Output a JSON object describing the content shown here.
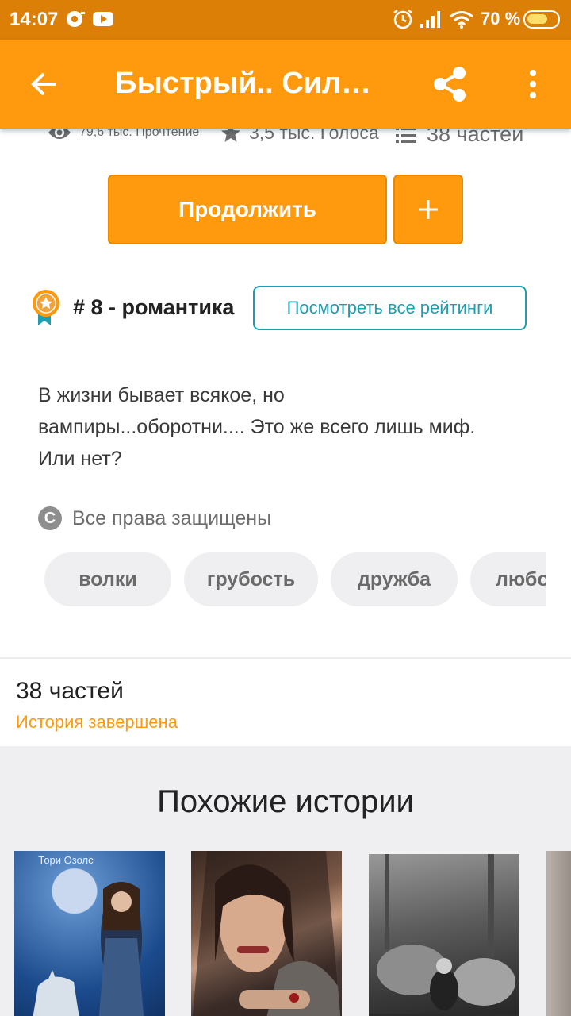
{
  "status_bar": {
    "time": "14:07",
    "battery_percent": "70 %",
    "battery_level": 0.7,
    "icons": [
      "media-icon",
      "youtube-icon",
      "alarm-icon",
      "signal-icon",
      "wifi-icon",
      "battery-icon"
    ]
  },
  "app_bar": {
    "title": "Быстрый.. Силь…",
    "back_icon": "arrow-left-icon",
    "share_icon": "share-icon",
    "menu_icon": "more-vertical-icon"
  },
  "stats": {
    "reads": "79,6 тыс. Прочтение",
    "votes": "3,5 тыс. Голоса",
    "parts": "38 частей"
  },
  "actions": {
    "continue_label": "Продолжить",
    "add_label": "+"
  },
  "ranking": {
    "text": "# 8 - романтика",
    "view_all_label": "Посмотреть все рейтинги"
  },
  "description": {
    "line1": "В жизни бывает всякое, но",
    "line2": "вампиры...оборотни.... Это же всего лишь миф.",
    "line3": "Или нет?"
  },
  "copyright": {
    "symbol": "C",
    "text": "Все права защищены"
  },
  "tags": [
    "волки",
    "грубость",
    "дружба",
    "любо"
  ],
  "parts_info": {
    "count": "38 частей",
    "status": "История завершена"
  },
  "similar": {
    "heading": "Похожие истории",
    "covers": [
      {
        "author": "Тори Озолс"
      },
      {
        "author": ""
      },
      {
        "author": ""
      },
      {
        "author": ""
      }
    ]
  },
  "colors": {
    "status_bar": "#db7f06",
    "accent": "#ff9a0e",
    "teal": "#1c9fb0",
    "tag_bg": "#efeef1"
  }
}
